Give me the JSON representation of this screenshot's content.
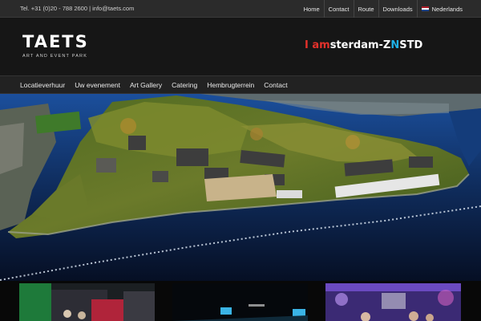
{
  "topbar": {
    "contact": "Tel. +31 (0)20 - 788 2600 | info@taets.com",
    "nav": [
      {
        "label": "Home"
      },
      {
        "label": "Contact"
      },
      {
        "label": "Route"
      },
      {
        "label": "Downloads"
      },
      {
        "label": "Nederlands"
      }
    ]
  },
  "header": {
    "logo_title": "TAETS",
    "logo_subtitle": "ART AND EVENT PARK",
    "partner": {
      "i": "I",
      "am": "am",
      "rest": "sterdam-",
      "z": "Z",
      "n": "N",
      "std": "STD"
    }
  },
  "mainnav": {
    "items": [
      {
        "label": "Locatieverhuur"
      },
      {
        "label": "Uw evenement"
      },
      {
        "label": "Art Gallery"
      },
      {
        "label": "Catering"
      },
      {
        "label": "Hembrugterrein"
      },
      {
        "label": "Contact"
      }
    ]
  },
  "colors": {
    "accent_red": "#e4312b",
    "accent_blue": "#1fb0e6",
    "topbar_bg": "#2b2b2b",
    "nav_bg": "#222222"
  }
}
